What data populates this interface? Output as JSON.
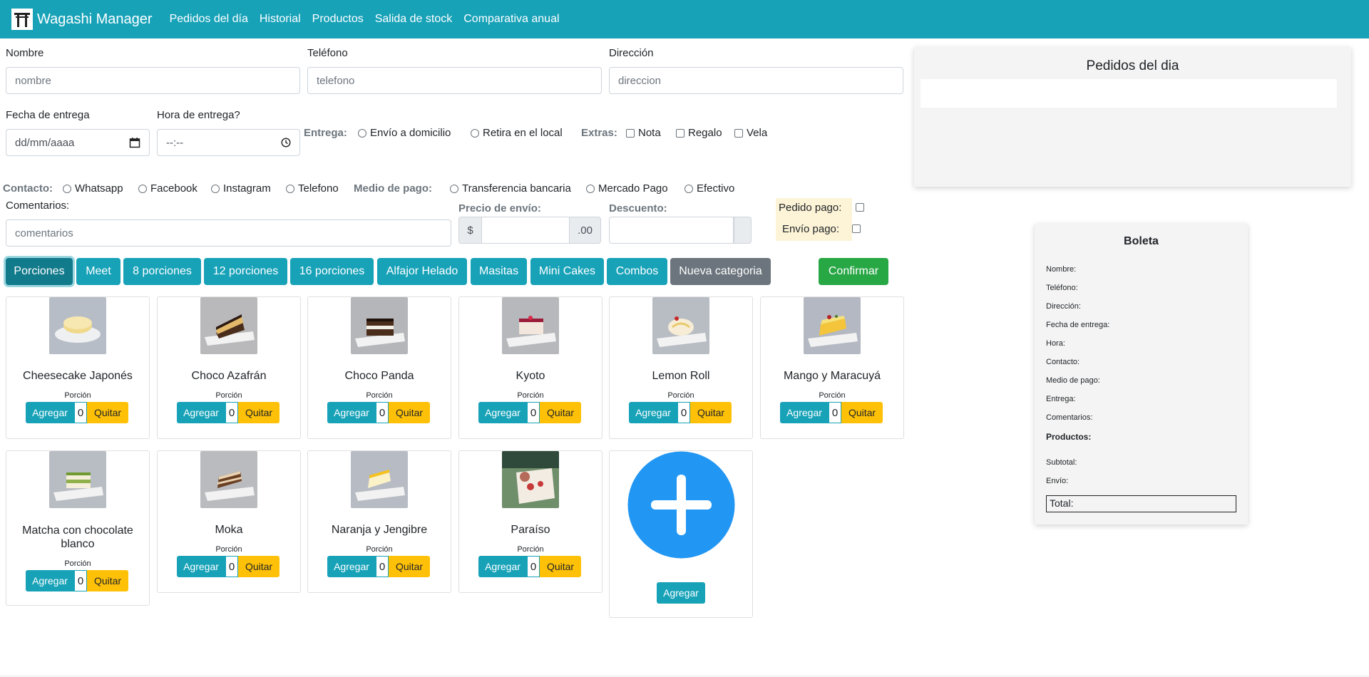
{
  "app": {
    "title": "Wagashi Manager"
  },
  "nav": [
    {
      "label": "Pedidos del día"
    },
    {
      "label": "Historial"
    },
    {
      "label": "Productos"
    },
    {
      "label": "Salida de stock"
    },
    {
      "label": "Comparativa anual"
    }
  ],
  "form": {
    "nombre": {
      "label": "Nombre",
      "placeholder": "nombre"
    },
    "telefono": {
      "label": "Teléfono",
      "placeholder": "telefono"
    },
    "direccion": {
      "label": "Dirección",
      "placeholder": "direccion"
    },
    "fecha": {
      "label": "Fecha de entrega",
      "placeholder": "dd/mm/aaaa"
    },
    "hora": {
      "label": "Hora de entrega?",
      "placeholder": "--:--"
    },
    "entrega": {
      "label": "Entrega:",
      "options": [
        "Envío a domicilio",
        "Retira en el local"
      ]
    },
    "extras": {
      "label": "Extras:",
      "options": [
        "Nota",
        "Regalo",
        "Vela"
      ]
    },
    "contacto": {
      "label": "Contacto:",
      "options": [
        "Whatsapp",
        "Facebook",
        "Instagram",
        "Telefono"
      ]
    },
    "medio_pago": {
      "label": "Medio de pago:",
      "options": [
        "Transferencia bancaria",
        "Mercado Pago",
        "Efectivo"
      ]
    },
    "comentarios": {
      "label": "Comentarios:",
      "placeholder": "comentarios"
    },
    "precio_envio": {
      "label": "Precio de envío:",
      "prefix": "$",
      "suffix": ".00"
    },
    "descuento": {
      "label": "Descuento:"
    },
    "pedido_pago": "Pedido pago:",
    "envio_pago": "Envío pago:"
  },
  "categories": [
    {
      "label": "Porciones",
      "active": true
    },
    {
      "label": "Meet"
    },
    {
      "label": "8 porciones"
    },
    {
      "label": "12 porciones"
    },
    {
      "label": "16 porciones"
    },
    {
      "label": "Alfajor Helado"
    },
    {
      "label": "Masitas"
    },
    {
      "label": "Mini Cakes"
    },
    {
      "label": "Combos"
    },
    {
      "label": "Nueva categoria"
    }
  ],
  "confirm_label": "Confirmar",
  "products": [
    {
      "name": "Cheesecake Japonés",
      "unit": "Porción",
      "qty": "0"
    },
    {
      "name": "Choco Azafrán",
      "unit": "Porción",
      "qty": "0"
    },
    {
      "name": "Choco Panda",
      "unit": "Porción",
      "qty": "0"
    },
    {
      "name": "Kyoto",
      "unit": "Porción",
      "qty": "0"
    },
    {
      "name": "Lemon Roll",
      "unit": "Porción",
      "qty": "0"
    },
    {
      "name": "Mango y Maracuyá",
      "unit": "Porción",
      "qty": "0"
    },
    {
      "name": "Matcha con chocolate blanco",
      "unit": "Porción",
      "qty": "0"
    },
    {
      "name": "Moka",
      "unit": "Porción",
      "qty": "0"
    },
    {
      "name": "Naranja y Jengibre",
      "unit": "Porción",
      "qty": "0"
    },
    {
      "name": "Paraíso",
      "unit": "Porción",
      "qty": "0"
    }
  ],
  "buttons": {
    "add": "Agregar",
    "remove": "Quitar",
    "add_product": "Agregar"
  },
  "pedidos_panel": {
    "title": "Pedidos del dia"
  },
  "boleta": {
    "title": "Boleta",
    "rows": [
      "Nombre:",
      "Teléfono:",
      "Dirección:",
      "Fecha de entrega:",
      "Hora:",
      "Contacto:",
      "Medio de pago:",
      "Entrega:",
      "Comentarios:"
    ],
    "productos": "Productos:",
    "subtotal": "Subtotal:",
    "envio": "Envío:",
    "total": "Total:"
  },
  "colors": {
    "primary": "#17a2b8",
    "warning": "#ffc107",
    "success": "#28a745",
    "secondary": "#6c757d",
    "add_circle": "#2196f3"
  }
}
